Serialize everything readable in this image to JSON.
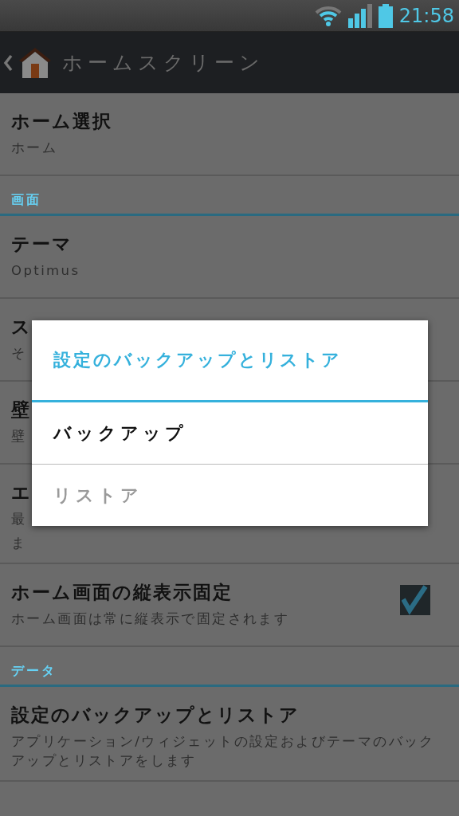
{
  "status_bar": {
    "time": "21:58"
  },
  "action_bar": {
    "title": "ホームスクリーン"
  },
  "list": [
    {
      "kind": "item",
      "title": "ホーム選択",
      "subtitle_lines": [
        "ホーム"
      ]
    },
    {
      "kind": "section",
      "title": "画面"
    },
    {
      "kind": "item",
      "title": "テーマ",
      "subtitle_lines": [
        "Optimus"
      ]
    },
    {
      "kind": "item",
      "title": "ス",
      "subtitle_lines": [
        "そ"
      ]
    },
    {
      "kind": "item",
      "title": "壁",
      "subtitle_lines": [
        "壁"
      ]
    },
    {
      "kind": "item",
      "title": "エ",
      "subtitle_lines": [
        "最",
        "ま"
      ]
    },
    {
      "kind": "checkbox",
      "title": "ホーム画面の縦表示固定",
      "subtitle_lines": [
        "ホーム画面は常に縦表示で固定されます"
      ],
      "checked": true
    },
    {
      "kind": "section",
      "title": "データ"
    },
    {
      "kind": "item",
      "title": "設定のバックアップとリストア",
      "subtitle_lines": [
        "アプリケーション/ウィジェットの設定およびテーマのバックアップとリストアをします"
      ]
    }
  ],
  "dialog": {
    "title": "設定のバックアップとリストア",
    "items": [
      {
        "label": "バックアップ",
        "disabled": false
      },
      {
        "label": "リストア",
        "disabled": true
      }
    ]
  }
}
